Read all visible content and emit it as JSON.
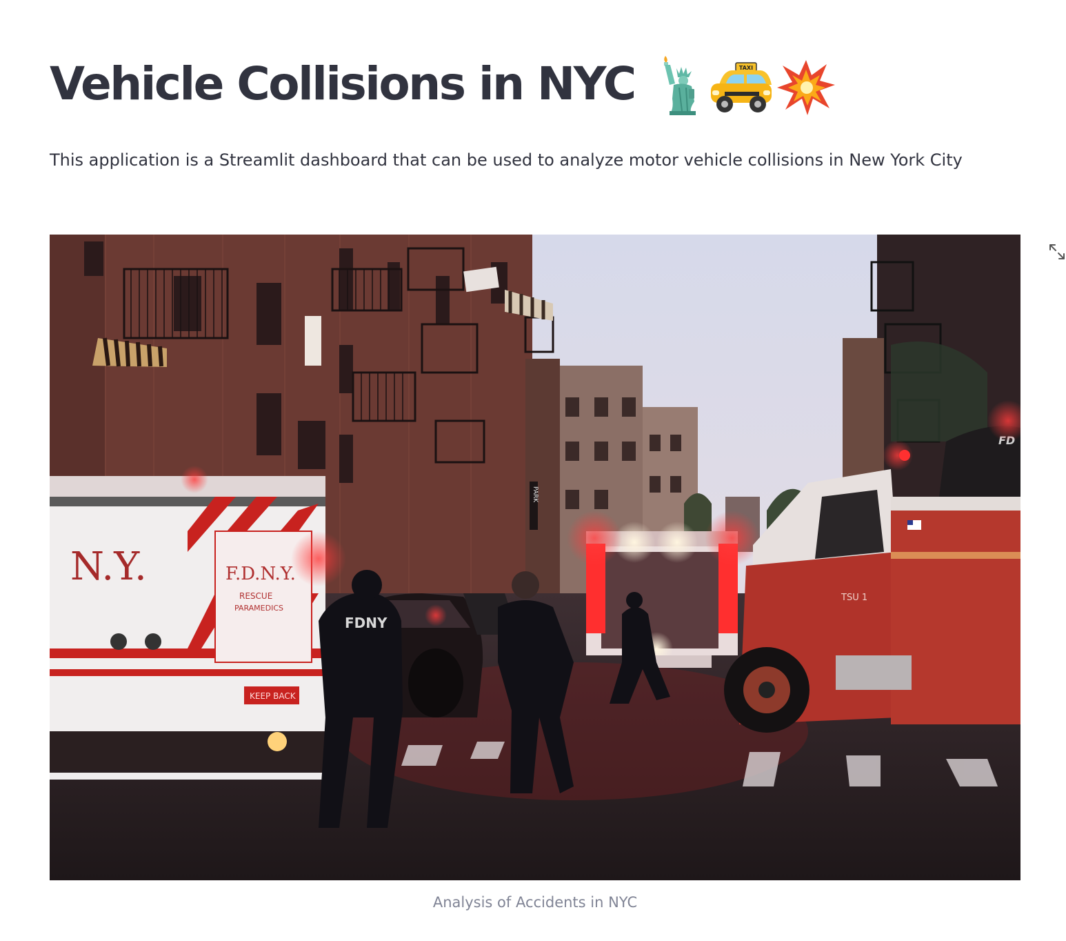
{
  "header": {
    "title": "Vehicle Collisions in NYC",
    "title_emojis": [
      "statue-of-liberty-icon",
      "taxi-icon",
      "collision-icon"
    ]
  },
  "description": "This application is a Streamlit dashboard that can be used to analyze motor vehicle collisions in New York City",
  "image": {
    "caption": "Analysis of Accidents in NYC",
    "fullscreen_icon": "expand-icon",
    "scene_text": {
      "ambulance_left_large": "N.Y.",
      "ambulance_left_side": "F.D.N.Y.",
      "ambulance_left_sub1": "RESCUE",
      "ambulance_left_sub2": "PARAMEDICS",
      "ambulance_left_keep_back": "KEEP BACK",
      "jacket_text": "FDNY",
      "truck_unit": "TSU 1",
      "truck_door": "FD",
      "parking_sign": "PARK",
      "taxi_sign": "TAXI"
    }
  },
  "colors": {
    "text": "#31333f",
    "caption": "#808495"
  }
}
